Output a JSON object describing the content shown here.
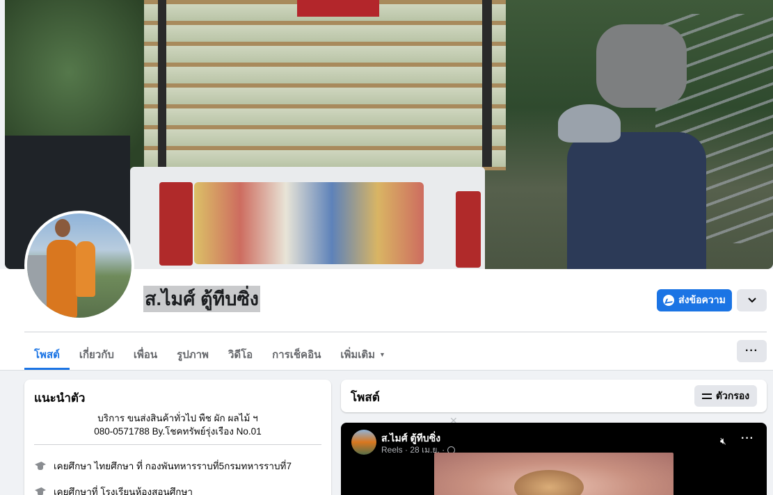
{
  "profile": {
    "name": "ส.ไมศ์ ตู้ทีบซิ่ง",
    "message_button": "ส่งข้อความ"
  },
  "tabs": [
    {
      "label": "โพสต์",
      "active": true
    },
    {
      "label": "เกี่ยวกับ",
      "active": false
    },
    {
      "label": "เพื่อน",
      "active": false
    },
    {
      "label": "รูปภาพ",
      "active": false
    },
    {
      "label": "วิดีโอ",
      "active": false
    },
    {
      "label": "การเช็คอิน",
      "active": false
    },
    {
      "label": "เพิ่มเติม",
      "active": false
    }
  ],
  "intro": {
    "title": "แนะนำตัว",
    "bio_line1": "บริการ ขนส่งสินค้าทั่วไป พืช ผัก ผลไม้ ฯ",
    "bio_line2": "080-0571788 By.โชคทรัพย์รุ่งเรือง No.01",
    "education1": "เคยศึกษา ไทยศึกษา ที่ กองพันทหารราบที่5กรมทหารราบที่7",
    "education2": "เคยศึกษาที่ โรงเรียนห้องสอนศึกษา"
  },
  "posts": {
    "title": "โพสต์",
    "filter_button": "ตัวกรอง"
  },
  "reel": {
    "author": "ส.ไมศ์ ตู้ทีบซิ่ง",
    "meta": "Reels · 28 เม.ย. ·"
  },
  "colors": {
    "accent": "#1b74e4",
    "background": "#f0f2f5"
  }
}
